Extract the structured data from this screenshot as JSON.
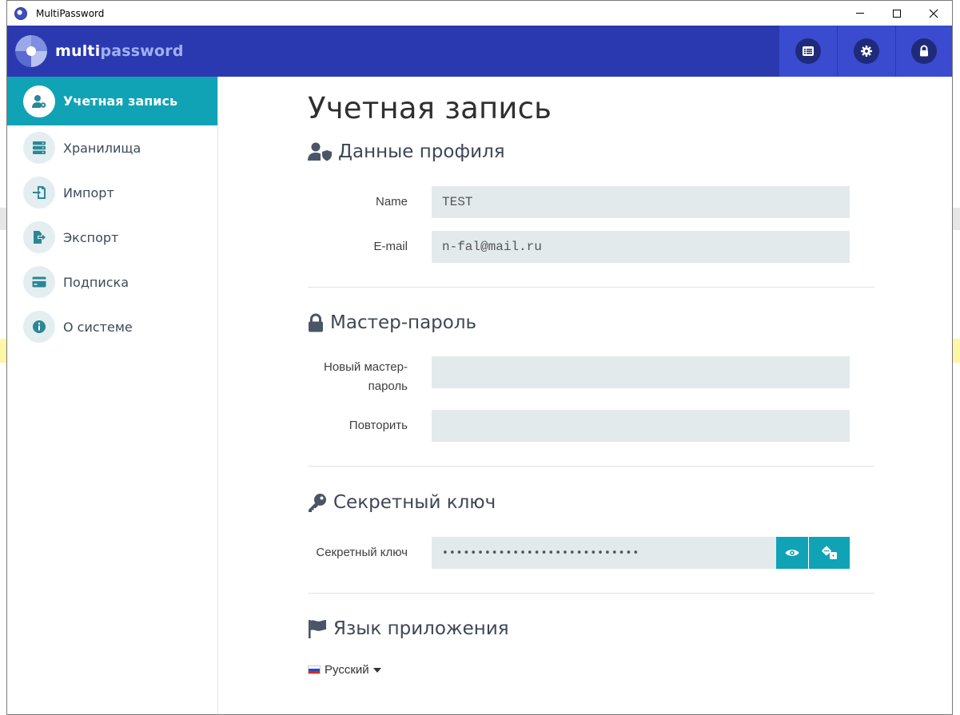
{
  "window": {
    "title": "MultiPassword"
  },
  "logo": {
    "part1": "multi",
    "part2": "password"
  },
  "sidebar": {
    "items": [
      {
        "label": "Учетная запись",
        "icon": "user-gear-icon",
        "active": true
      },
      {
        "label": "Хранилища",
        "icon": "server-icon"
      },
      {
        "label": "Импорт",
        "icon": "import-icon"
      },
      {
        "label": "Экспорт",
        "icon": "export-icon"
      },
      {
        "label": "Подписка",
        "icon": "credit-card-icon"
      },
      {
        "label": "О системе",
        "icon": "info-icon"
      }
    ]
  },
  "main": {
    "title": "Учетная запись",
    "profile": {
      "heading": "Данные профиля",
      "name_label": "Name",
      "name_value": "TEST",
      "email_label": "E-mail",
      "email_value": "n-fal@mail.ru"
    },
    "master": {
      "heading": "Мастер-пароль",
      "new_label": "Новый мастер-пароль",
      "repeat_label": "Повторить"
    },
    "secret": {
      "heading": "Секретный ключ",
      "key_label": "Секретный ключ",
      "key_value": "••••••••••••••••••••••••••••"
    },
    "language": {
      "heading": "Язык приложения",
      "selected": "Русский"
    }
  },
  "colors": {
    "header": "#2b39b0",
    "header_button": "#3a4bd0",
    "accent": "#10a3b6",
    "field_bg": "#e3eaec"
  }
}
